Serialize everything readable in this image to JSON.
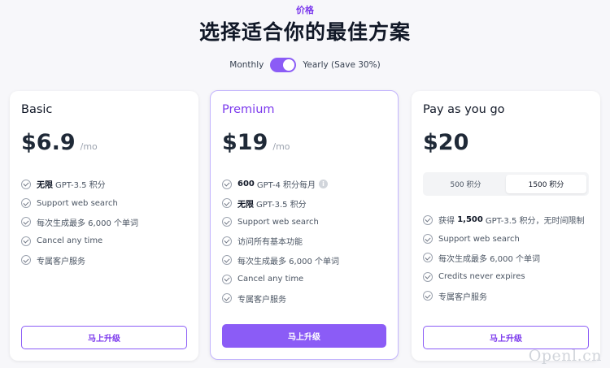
{
  "header": {
    "eyebrow": "价格",
    "title": "选择适合你的最佳方案"
  },
  "billing_toggle": {
    "monthly_label": "Monthly",
    "yearly_label": "Yearly (Save 30%)",
    "selected": "yearly"
  },
  "plans": [
    {
      "name": "Basic",
      "price": "$6.9",
      "per": "/mo",
      "features": [
        {
          "bold": "无限",
          "text": "GPT-3.5 积分"
        },
        {
          "bold": "",
          "text": "Support web search"
        },
        {
          "bold": "",
          "text": "每次生成最多 6,000 个单词"
        },
        {
          "bold": "",
          "text": "Cancel any time"
        },
        {
          "bold": "",
          "text": "专属客户服务"
        }
      ],
      "cta": "马上升级"
    },
    {
      "name": "Premium",
      "price": "$19",
      "per": "/mo",
      "features": [
        {
          "bold": "600",
          "text": "GPT-4 积分每月"
        },
        {
          "bold": "无限",
          "text": "GPT-3.5 积分"
        },
        {
          "bold": "",
          "text": "Support web search"
        },
        {
          "bold": "",
          "text": "访问所有基本功能"
        },
        {
          "bold": "",
          "text": "每次生成最多 6,000 个单词"
        },
        {
          "bold": "",
          "text": "Cancel any time"
        },
        {
          "bold": "",
          "text": "专属客户服务"
        }
      ],
      "cta": "马上升级"
    },
    {
      "name": "Pay as you go",
      "price": "$20",
      "credit_options": [
        "500 积分",
        "1500 积分"
      ],
      "selected_credit": "1500 积分",
      "features": [
        {
          "pre": "获得",
          "bold": "1,500",
          "text": "GPT-3.5 积分，无时间限制"
        },
        {
          "pre": "",
          "bold": "",
          "text": "Support web search"
        },
        {
          "pre": "",
          "bold": "",
          "text": "每次生成最多 6,000 个单词"
        },
        {
          "pre": "",
          "bold": "",
          "text": "Credits never expires"
        },
        {
          "pre": "",
          "bold": "",
          "text": "专属客户服务"
        }
      ],
      "cta": "马上升级"
    }
  ],
  "watermark": "Openl.cn",
  "colors": {
    "accent": "#8b5cf6",
    "accent_text": "#7c3aed",
    "background": "#f7f7fa"
  }
}
